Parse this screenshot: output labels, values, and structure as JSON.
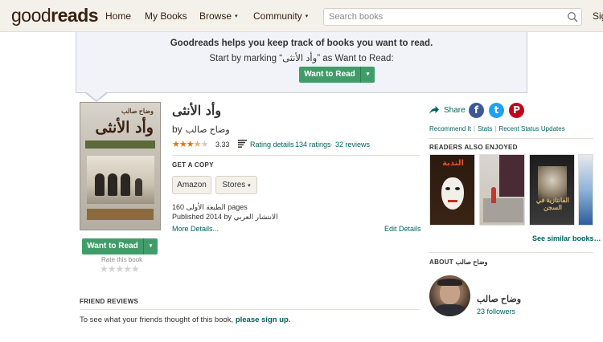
{
  "header": {
    "logo_light": "good",
    "logo_bold": "reads",
    "nav": [
      {
        "label": "Home"
      },
      {
        "label": "My Books"
      },
      {
        "label": "Browse",
        "dropdown": "▾"
      },
      {
        "label": "Community",
        "dropdown": "▾"
      }
    ],
    "search_placeholder": "Search books",
    "signin_partial": "Sig"
  },
  "banner": {
    "title": "Goodreads helps you keep track of books you want to read.",
    "subtitle": "Start by marking “وأد الأنثى” as Want to Read:",
    "button_label": "Want to Read",
    "button_dropdown": "▾"
  },
  "book": {
    "cover": {
      "author": "وضاح صالب",
      "title": "وأد الأنثى"
    },
    "title": "وأد الأنثى",
    "by": "by",
    "author": "وضاح صالب",
    "stars": [
      "★",
      "★",
      "★",
      "★",
      "★"
    ],
    "avg_rating": "3.33",
    "rating_details": "Rating details",
    "ratings": "134 ratings",
    "reviews": "32 reviews",
    "dot": "·",
    "get_copy": "GET A COPY",
    "stores": [
      "Amazon",
      "Stores"
    ],
    "stores_caret": "▾",
    "pages": "160 الطبعة الأولى pages",
    "published": "Published 2014 by الانتشار العربي",
    "more_details": "More Details...",
    "edit_details": "Edit Details",
    "want_to_read": "Want to Read",
    "want_dropdown": "▾",
    "rate_label": "Rate this book",
    "rate_stars": "★★★★★"
  },
  "sidebar": {
    "share": "Share",
    "social": [
      {
        "name": "facebook",
        "glyph": "f",
        "color": "#3b5998"
      },
      {
        "name": "twitter",
        "glyph": "t",
        "color": "#1da1f2"
      },
      {
        "name": "pinterest",
        "glyph": "P",
        "color": "#bd081c"
      }
    ],
    "links": [
      "Recommend It",
      "Stats",
      "Recent Status Updates"
    ],
    "sep": "|",
    "also_enjoyed": "READERS ALSO ENJOYED",
    "thumb_titles": [
      "الندبة",
      "",
      "الفانتازية في السجن",
      ""
    ],
    "see_similar": "See similar books…",
    "about": "ABOUT وضاح صالب",
    "author_name": "وضاح صالب",
    "followers": "23 followers"
  },
  "friend_reviews": {
    "heading": "FRIEND REVIEWS",
    "text": "To see what your friends thought of this book,",
    "signup": "please sign up."
  },
  "colors": {
    "header_bg": "#f4f1ea",
    "banner_bg": "#f2f3f8",
    "green_button": "#409d69",
    "link": "#00635d",
    "star": "#e87400"
  }
}
